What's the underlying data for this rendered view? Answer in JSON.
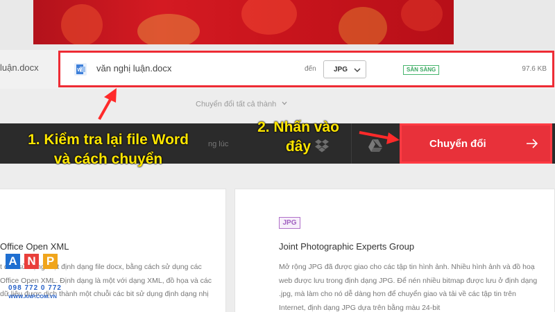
{
  "file_list": {
    "left_file_name": "luận.docx",
    "file": {
      "name": "văn nghị luận.docx",
      "to_label": "đến",
      "format": "JPG",
      "status": "SẴN SÀNG",
      "size": "97.6 KB"
    },
    "convert_all_label": "Chuyển đổi tất cả thành"
  },
  "action_bar": {
    "hint": "ng lúc",
    "convert_label": "Chuyển đổi",
    "icons": [
      "dropbox-icon",
      "google-drive-icon",
      "arrow-right-icon"
    ]
  },
  "cards": {
    "left": {
      "title": "Office Open XML",
      "body": "t đầu sử dụng một định dạng file docx, bằng cách sử dụng các Office Open XML. Định dạng là một với dạng XML, đồ họa và các dữ liệu được dịch thành một chuỗi các bit sử dụng định dạng nhị"
    },
    "right": {
      "badge": "JPG",
      "title": "Joint Photographic Experts Group",
      "body": "Mở rộng JPG đã được giao cho các tập tin hình ảnh. Nhiều hình ảnh và đồ hoạ web được lưu trong định dạng JPG. Để nén nhiều bitmap được lưu ở định dạng .jpg, mà làm cho nó dễ dàng hơn để chuyển giao và tải về các tập tin trên Internet, định dạng JPG dựa trên bằng màu 24-bit"
    }
  },
  "annotations": {
    "step1_line1": "1. Kiểm tra lại file Word",
    "step1_line2": "và cách chuyển",
    "step2_line1": "2. Nhấn vào",
    "step2_line2": "đây",
    "color": "#ffe600"
  },
  "logo": {
    "letters": [
      "A",
      "N",
      "P"
    ],
    "phone": "098 772 0 772",
    "site": "WWW.ANP.COM.VN"
  },
  "colors": {
    "accent_red": "#e8313a",
    "highlight_border": "#ee2b34",
    "status_green": "#3aa760",
    "dark_bar": "#2b2b2b"
  }
}
